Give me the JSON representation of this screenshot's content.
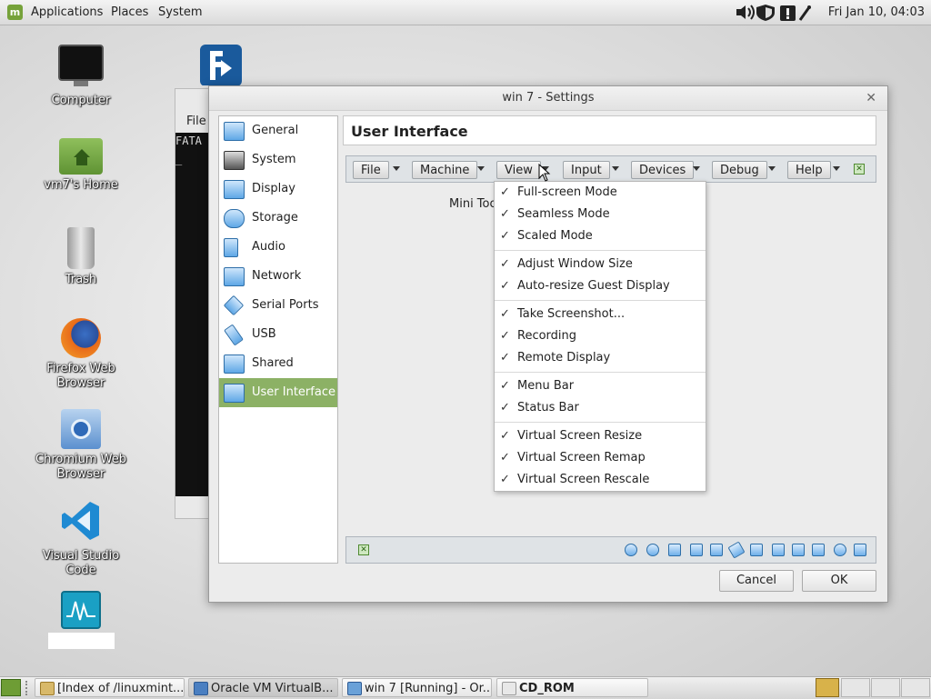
{
  "top_panel": {
    "menus": [
      "Applications",
      "Places",
      "System"
    ],
    "clock": "Fri Jan 10, 04:03"
  },
  "desktop_icons": [
    {
      "label": "Computer",
      "icon": "monitor-icon"
    },
    {
      "label": "vm7's Home",
      "icon": "home-folder-icon"
    },
    {
      "label": "Trash",
      "icon": "trash-icon"
    },
    {
      "label": "Firefox Web Browser",
      "icon": "firefox-icon"
    },
    {
      "label": "Chromium Web Browser",
      "icon": "chromium-icon"
    },
    {
      "label": "Visual Studio Code",
      "icon": "vscode-icon"
    },
    {
      "label": "",
      "icon": "system-monitor-icon"
    }
  ],
  "background_window": {
    "menu_label": "File",
    "terminal_text": "FATA"
  },
  "dialog": {
    "title": "win 7 - Settings",
    "sidebar": [
      {
        "label": "General",
        "icon": "general-icon"
      },
      {
        "label": "System",
        "icon": "system-icon"
      },
      {
        "label": "Display",
        "icon": "display-icon"
      },
      {
        "label": "Storage",
        "icon": "storage-icon"
      },
      {
        "label": "Audio",
        "icon": "audio-icon"
      },
      {
        "label": "Network",
        "icon": "network-icon"
      },
      {
        "label": "Serial Ports",
        "icon": "serial-ports-icon"
      },
      {
        "label": "USB",
        "icon": "usb-icon"
      },
      {
        "label": "Shared Folders",
        "icon": "shared-folders-icon"
      },
      {
        "label": "User Interface",
        "icon": "user-interface-icon",
        "selected": true
      }
    ],
    "page_title": "User Interface",
    "menubar_buttons": [
      "File",
      "Machine",
      "View",
      "Input",
      "Devices",
      "Debug",
      "Help"
    ],
    "mini_toolbar_label": "Mini Too",
    "buttons": {
      "cancel": "Cancel",
      "ok": "OK"
    }
  },
  "view_menu": {
    "groups": [
      [
        {
          "label": "Full-screen Mode",
          "checked": true
        },
        {
          "label": "Seamless Mode",
          "checked": true
        },
        {
          "label": "Scaled Mode",
          "checked": true
        }
      ],
      [
        {
          "label": "Adjust Window Size",
          "checked": true
        },
        {
          "label": "Auto-resize Guest Display",
          "checked": true
        }
      ],
      [
        {
          "label": "Take Screenshot...",
          "checked": true
        },
        {
          "label": "Recording",
          "checked": true
        },
        {
          "label": "Remote Display",
          "checked": true
        }
      ],
      [
        {
          "label": "Menu Bar",
          "checked": true
        },
        {
          "label": "Status Bar",
          "checked": true
        }
      ],
      [
        {
          "label": "Virtual Screen Resize",
          "checked": true
        },
        {
          "label": "Virtual Screen Remap",
          "checked": true
        },
        {
          "label": "Virtual Screen Rescale",
          "checked": true
        }
      ]
    ],
    "check_glyph": "✓"
  },
  "taskbar": {
    "tasks": [
      {
        "label": "[Index of /linuxmint...",
        "icon": "firefox-icon"
      },
      {
        "label": "Oracle VM VirtualB...",
        "icon": "virtualbox-icon"
      },
      {
        "label": "win 7 [Running] - Or...",
        "icon": "vm-window-icon"
      },
      {
        "label": "CD_ROM",
        "icon": "cd-rom-icon"
      }
    ]
  },
  "colors": {
    "selected": "#8cb165",
    "accent": "#2d6ea8"
  }
}
